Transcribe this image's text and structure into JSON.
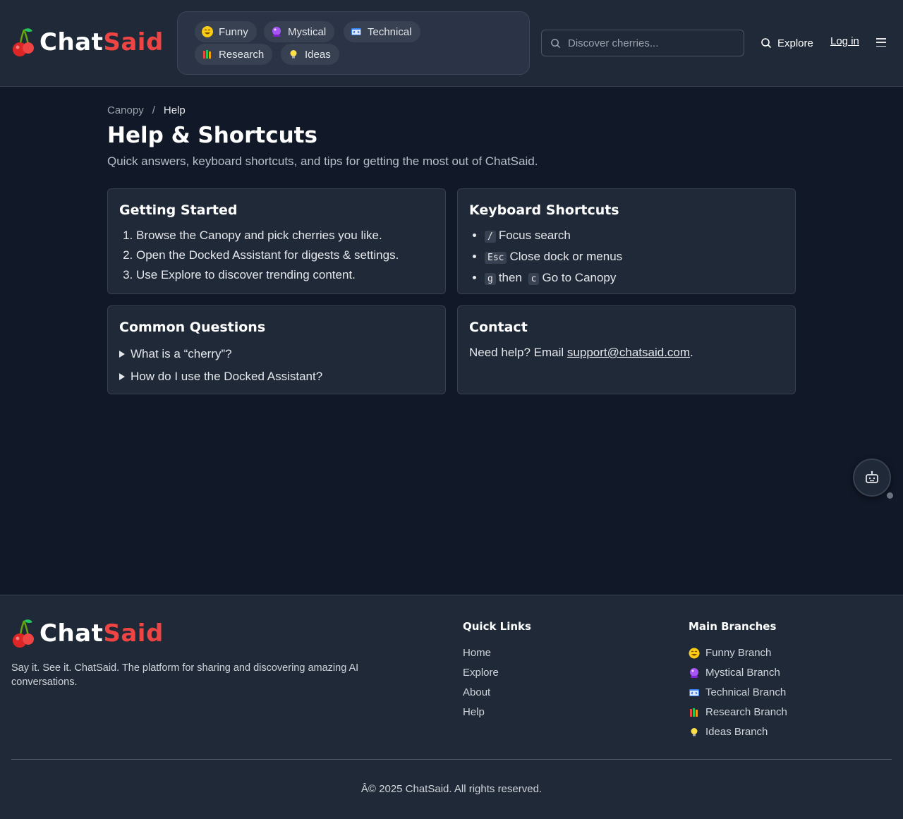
{
  "header": {
    "logo": {
      "part1": "Chat",
      "part2": "Said"
    },
    "branches": [
      {
        "label": "Funny",
        "icon": "laughing-emoji-icon",
        "emoji": "😂",
        "color": "#facc15"
      },
      {
        "label": "Mystical",
        "icon": "crystal-ball-icon",
        "emoji": "🔮",
        "color": "#a855f7"
      },
      {
        "label": "Technical",
        "icon": "code-window-icon",
        "emoji": "🧑‍💻",
        "color": "#60a5fa"
      },
      {
        "label": "Research",
        "icon": "books-icon",
        "emoji": "📚",
        "color": "#f59e0b"
      },
      {
        "label": "Ideas",
        "icon": "lightbulb-icon",
        "emoji": "💡",
        "color": "#fde047"
      }
    ],
    "search": {
      "placeholder": "Discover cherries..."
    },
    "explore_label": "Explore",
    "login_label": "Log in"
  },
  "breadcrumb": {
    "root": "Canopy",
    "separator": "/",
    "current": "Help"
  },
  "page": {
    "title": "Help & Shortcuts",
    "subtitle": "Quick answers, keyboard shortcuts, and tips for getting the most out of ChatSaid."
  },
  "cards": {
    "getting_started": {
      "title": "Getting Started",
      "steps": [
        "Browse the Canopy and pick cherries you like.",
        "Open the Docked Assistant for digests & settings.",
        "Use Explore to discover trending content."
      ]
    },
    "shortcuts": {
      "title": "Keyboard Shortcuts",
      "items": [
        {
          "key": "/",
          "label": "Focus search"
        },
        {
          "key": "Esc",
          "label": "Close dock or menus"
        },
        {
          "key": "g",
          "then": "then",
          "key2": "c",
          "label": "Go to Canopy"
        }
      ]
    },
    "questions": {
      "title": "Common Questions",
      "items": [
        "What is a “cherry”?",
        "How do I use the Docked Assistant?"
      ]
    },
    "contact": {
      "title": "Contact",
      "text": "Need help? Email ",
      "email": "support@chatsaid.com",
      "suffix": "."
    }
  },
  "footer": {
    "logo": {
      "part1": "Chat",
      "part2": "Said"
    },
    "description": "Say it. See it. ChatSaid. The platform for sharing and discovering amazing AI conversations.",
    "quick_links": {
      "title": "Quick Links",
      "items": [
        "Home",
        "Explore",
        "About",
        "Help"
      ]
    },
    "main_branches": {
      "title": "Main Branches",
      "items": [
        {
          "label": "Funny Branch",
          "icon": "laughing-emoji-icon"
        },
        {
          "label": "Mystical Branch",
          "icon": "crystal-ball-icon"
        },
        {
          "label": "Technical Branch",
          "icon": "code-window-icon"
        },
        {
          "label": "Research Branch",
          "icon": "books-icon"
        },
        {
          "label": "Ideas Branch",
          "icon": "lightbulb-icon"
        }
      ]
    },
    "copyright": "Â© 2025 ChatSaid. All rights reserved."
  },
  "colors": {
    "accent": "#ef4444",
    "background": "#111827",
    "surface": "#1f2937",
    "border": "#374151"
  }
}
